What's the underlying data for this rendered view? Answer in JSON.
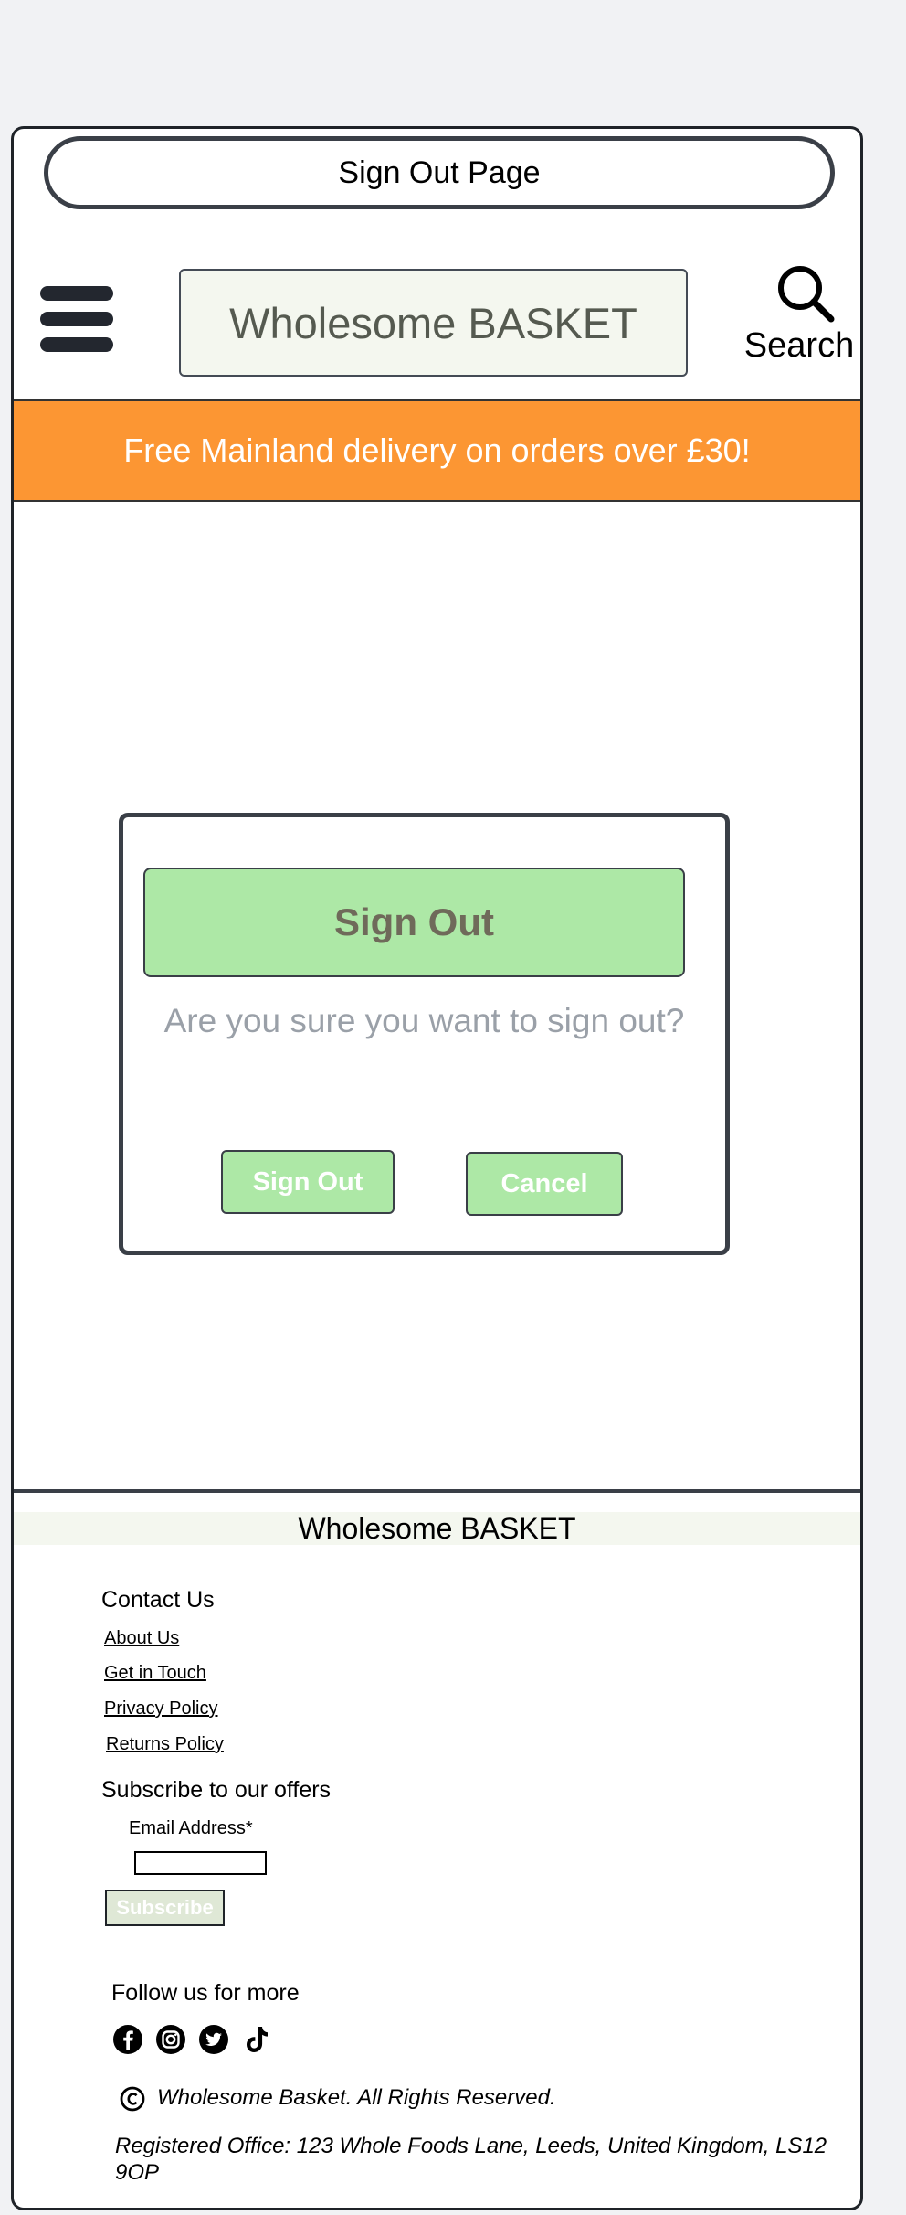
{
  "page_title": "Sign Out Page",
  "header": {
    "menu_icon": "hamburger-icon",
    "logo_text": "Wholesome BASKET",
    "search_icon": "magnifier-icon",
    "search_label": "Search"
  },
  "banner": {
    "text": "Free Mainland delivery on orders over £30!",
    "color": "#fc9633"
  },
  "dialog": {
    "title": "Sign Out",
    "message": "Are you sure you want to sign out?",
    "confirm_label": "Sign Out",
    "cancel_label": "Cancel",
    "accent": "#ade8a6"
  },
  "footer": {
    "brand": "Wholesome BASKET",
    "contact_heading": "Contact Us",
    "links": [
      "About Us",
      "Get in Touch",
      "Privacy Policy",
      "Returns Policy"
    ],
    "subscribe_heading": "Subscribe to our offers",
    "email_label": "Email Address*",
    "email_value": "",
    "subscribe_label": "Subscribe",
    "follow_heading": "Follow us for more",
    "social_icons": [
      "facebook-icon",
      "instagram-icon",
      "twitter-icon",
      "tiktok-icon"
    ],
    "copyright_symbol": "copyright-icon",
    "rights": "Wholesome Basket. All Rights Reserved.",
    "registered_office": "Registered Office: 123 Whole Foods Lane, Leeds, United Kingdom, LS12 9OP"
  }
}
